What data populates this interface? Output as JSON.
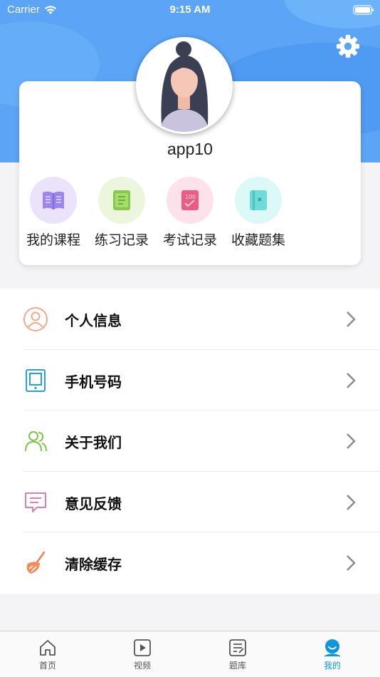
{
  "status_bar": {
    "carrier": "Carrier",
    "time": "9:15 AM"
  },
  "profile": {
    "username": "app10"
  },
  "quick_actions": [
    {
      "label": "我的课程",
      "icon": "book-icon",
      "color": "#8a6fe8"
    },
    {
      "label": "练习记录",
      "icon": "practice-notebook-icon",
      "color": "#7dc142"
    },
    {
      "label": "考试记录",
      "icon": "exam-score-icon",
      "color": "#e8457a"
    },
    {
      "label": "收藏题集",
      "icon": "bookmark-collection-icon",
      "color": "#4fd4d4"
    }
  ],
  "menu": [
    {
      "label": "个人信息",
      "icon": "user-icon"
    },
    {
      "label": "手机号码",
      "icon": "phone-icon"
    },
    {
      "label": "关于我们",
      "icon": "group-icon"
    },
    {
      "label": "意见反馈",
      "icon": "feedback-icon"
    },
    {
      "label": "清除缓存",
      "icon": "broom-icon"
    }
  ],
  "tabs": [
    {
      "label": "首页",
      "icon": "home-icon",
      "active": false
    },
    {
      "label": "视频",
      "icon": "video-icon",
      "active": false
    },
    {
      "label": "题库",
      "icon": "question-bank-icon",
      "active": false
    },
    {
      "label": "我的",
      "icon": "profile-icon",
      "active": true
    }
  ],
  "colors": {
    "header_blue": "#5ba4f6",
    "active_tab": "#1296db"
  }
}
